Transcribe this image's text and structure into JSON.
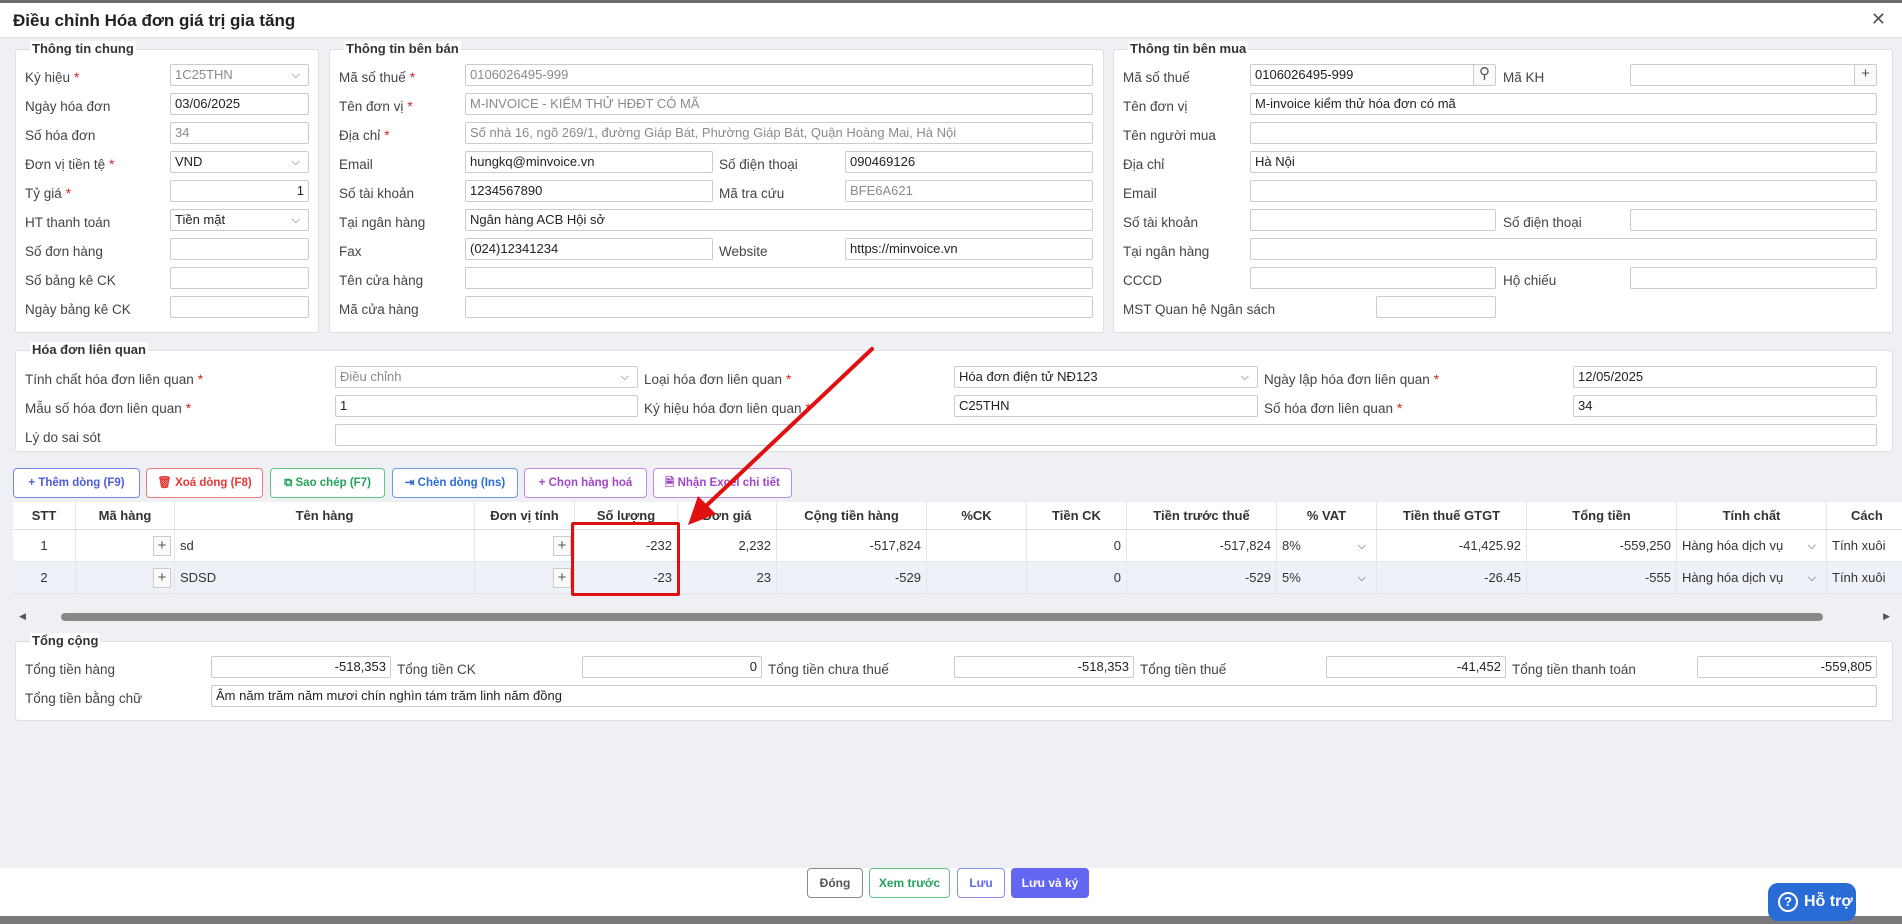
{
  "window": {
    "title": "Điều chỉnh Hóa đơn giá trị gia tăng",
    "close_glyph": "✕"
  },
  "general": {
    "legend": "Thông tin chung",
    "fields": [
      {
        "label": "Ký hiệu",
        "required": "*",
        "value": "1C25THN"
      },
      {
        "label": "Ngày hóa đơn",
        "required": "",
        "value": "03/06/2025"
      },
      {
        "label": "Số hóa đơn",
        "required": "",
        "value": "34"
      },
      {
        "label": "Đơn vị tiền tệ",
        "required": "*",
        "value": "VND"
      },
      {
        "label": "Tỷ giá",
        "required": "*",
        "value": "1"
      },
      {
        "label": "HT thanh toán",
        "required": "",
        "value": "Tiền mặt"
      },
      {
        "label": "Số đơn hàng",
        "required": "",
        "value": ""
      },
      {
        "label": "Số bảng kê CK",
        "required": "",
        "value": ""
      },
      {
        "label": "Ngày bảng kê CK",
        "required": "",
        "value": ""
      }
    ]
  },
  "seller": {
    "legend": "Thông tin bên bán",
    "tax_code": {
      "label": "Mã số thuế",
      "required": "*",
      "value": "0106026495-999"
    },
    "unit_name": {
      "label": "Tên đơn vị",
      "required": "*",
      "value": "M-INVOICE - KIỂM THỬ HĐĐT CÓ MÃ"
    },
    "address": {
      "label": "Địa chỉ",
      "required": "*",
      "value": "Số nhà 16, ngõ 269/1, đường Giáp Bát, Phường Giáp Bát, Quận Hoàng Mai, Hà Nội"
    },
    "email": {
      "label": "Email",
      "value": "hungkq@minvoice.vn"
    },
    "phone": {
      "label": "Số điện thoại",
      "value": "090469126"
    },
    "account": {
      "label": "Số tài khoản",
      "value": "1234567890"
    },
    "lookup": {
      "label": "Mã tra cứu",
      "value": "BFE6A621"
    },
    "bank": {
      "label": "Tại ngân hàng",
      "value": "Ngân hàng ACB Hội sở"
    },
    "fax": {
      "label": "Fax",
      "value": "(024)12341234"
    },
    "website": {
      "label": "Website",
      "value": "https://minvoice.vn"
    },
    "store_name": {
      "label": "Tên cửa hàng",
      "value": ""
    },
    "store_code": {
      "label": "Mã cửa hàng",
      "value": ""
    }
  },
  "buyer": {
    "legend": "Thông tin bên mua",
    "tax_code": {
      "label": "Mã số thuế",
      "value": "0106026495-999"
    },
    "customer_code": {
      "label": "Mã KH",
      "value": ""
    },
    "unit_name": {
      "label": "Tên đơn vị",
      "value": "M-invoice kiểm thử hóa đơn có mã"
    },
    "buyer_name": {
      "label": "Tên người mua",
      "value": ""
    },
    "address": {
      "label": "Địa chỉ",
      "value": "Hà Nội"
    },
    "email": {
      "label": "Email",
      "value": ""
    },
    "account": {
      "label": "Số tài khoản",
      "value": ""
    },
    "phone": {
      "label": "Số điện thoại",
      "value": ""
    },
    "bank": {
      "label": "Tại ngân hàng",
      "value": ""
    },
    "cccd": {
      "label": "CCCD",
      "value": ""
    },
    "passport": {
      "label": "Hộ chiếu",
      "value": ""
    },
    "budget": {
      "label": "MST Quan hệ Ngân sách",
      "value": ""
    }
  },
  "related": {
    "legend": "Hóa đơn liên quan",
    "nature": {
      "label": "Tính chất hóa đơn liên quan",
      "required": "*",
      "value": "Điều chỉnh"
    },
    "type": {
      "label": "Loại hóa đơn liên quan",
      "required": "*",
      "value": "Hóa đơn điện tử NĐ123"
    },
    "date": {
      "label": "Ngày lập hóa đơn liên quan",
      "required": "*",
      "value": "12/05/2025"
    },
    "template": {
      "label": "Mẫu số hóa đơn liên quan",
      "required": "*",
      "value": "1"
    },
    "symbol": {
      "label": "Ký hiệu hóa đơn liên quan",
      "required": "*",
      "value": "C25THN"
    },
    "number": {
      "label": "Số hóa đơn liên quan",
      "required": "*",
      "value": "34"
    },
    "reason": {
      "label": "Lý do sai sót",
      "value": ""
    }
  },
  "toolbar": {
    "add": "Thêm dòng (F9)",
    "delete": "Xoá dòng (F8)",
    "copy": "Sao chép (F7)",
    "insert": "Chèn dòng (Ins)",
    "choose": "Chọn hàng hoá",
    "excel": "Nhận Excel chi tiết"
  },
  "table": {
    "headers": [
      "STT",
      "Mã hàng",
      "Tên hàng",
      "Đơn vị tính",
      "Số lượng",
      "Đơn giá",
      "Cộng tiền hàng",
      "%CK",
      "Tiền CK",
      "Tiền trước thuế",
      "% VAT",
      "Tiền thuế GTGT",
      "Tổng tiền",
      "Tính chất",
      "Cách"
    ],
    "rows": [
      {
        "stt": "1",
        "code": "",
        "name": "sd",
        "unit": "",
        "qty": "-232",
        "price": "2,232",
        "amount": "-517,824",
        "ck": "",
        "ck_amount": "0",
        "pretax": "-517,824",
        "vat": "8%",
        "vat_amount": "-41,425.92",
        "total": "-559,250",
        "nature": "Hàng hóa dịch vụ",
        "method": "Tính xuôi"
      },
      {
        "stt": "2",
        "code": "",
        "name": "SDSD",
        "unit": "",
        "qty": "-23",
        "price": "23",
        "amount": "-529",
        "ck": "",
        "ck_amount": "0",
        "pretax": "-529",
        "vat": "5%",
        "vat_amount": "-26.45",
        "total": "-555",
        "nature": "Hàng hóa dịch vụ",
        "method": "Tính xuôi"
      }
    ]
  },
  "totals": {
    "legend": "Tổng cộng",
    "goods": {
      "label": "Tổng tiền hàng",
      "value": "-518,353"
    },
    "ck": {
      "label": "Tổng tiền CK",
      "value": "0"
    },
    "pretax": {
      "label": "Tổng tiền chưa thuế",
      "value": "-518,353"
    },
    "tax": {
      "label": "Tổng tiền thuế",
      "value": "-41,452"
    },
    "payment": {
      "label": "Tổng tiền thanh toán",
      "value": "-559,805"
    },
    "words": {
      "label": "Tổng tiền bằng chữ",
      "value": "Âm năm trăm năm mươi chín nghìn tám trăm linh năm đồng"
    }
  },
  "footer": {
    "close": "Đóng",
    "preview": "Xem trước",
    "save": "Lưu",
    "save_sign": "Lưu và ký"
  },
  "help": {
    "label": "Hỗ trợ",
    "glyph": "?"
  },
  "colors": {
    "primary": "#6366f1",
    "danger": "#e53935",
    "success": "#22a35a",
    "annotation": "#e01010"
  }
}
